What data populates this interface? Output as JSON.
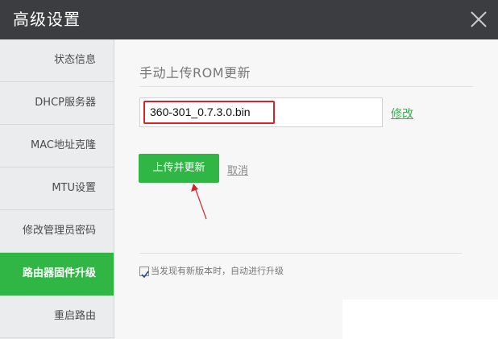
{
  "window": {
    "title": "高级设置",
    "close_icon": "close-icon"
  },
  "sidebar": {
    "active_index": 5,
    "items": [
      {
        "label": "状态信息"
      },
      {
        "label": "DHCP服务器"
      },
      {
        "label": "MAC地址克隆"
      },
      {
        "label": "MTU设置"
      },
      {
        "label": "修改管理员密码"
      },
      {
        "label": "路由器固件升级"
      },
      {
        "label": "重启路由"
      }
    ]
  },
  "main": {
    "section_title": "手动上传ROM更新",
    "file_value": "360-301_0.7.3.0.bin",
    "modify_label": "修改",
    "upload_label": "上传并更新",
    "cancel_label": "取消",
    "auto_update": {
      "checked": true,
      "label": "当发现有新版本时，自动进行升级"
    }
  },
  "colors": {
    "accent": "#2fb644",
    "titlebar": "#3b3d41",
    "highlight_border": "#d6232a",
    "annotation_arrow": "#d6232a"
  }
}
